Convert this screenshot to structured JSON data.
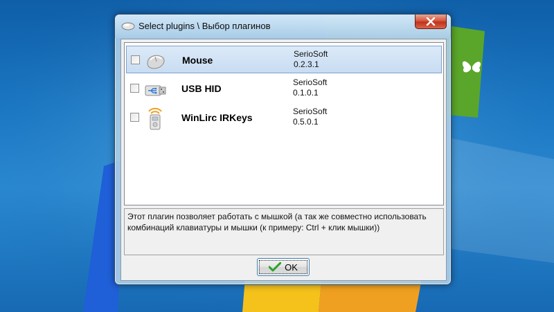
{
  "window": {
    "title": "Select plugins \\ Выбор плагинов",
    "close_icon": "close-icon"
  },
  "plugins": [
    {
      "name": "Mouse",
      "vendor": "SerioSoft",
      "version": "0.2.3.1",
      "icon": "mouse-icon",
      "checked": false,
      "selected": true
    },
    {
      "name": "USB HID",
      "vendor": "SerioSoft",
      "version": "0.1.0.1",
      "icon": "usb-icon",
      "checked": false,
      "selected": false
    },
    {
      "name": "WinLirc IRKeys",
      "vendor": "SerioSoft",
      "version": "0.5.0.1",
      "icon": "ir-remote-icon",
      "checked": false,
      "selected": false
    }
  ],
  "description": "Этот плагин позволяет работать с мышкой (а так же совместно использовать комбинаций клавиатуры и мышки (к примеру: Ctrl + клик мышки))",
  "ok_button": {
    "label": "OK",
    "icon": "checkmark-icon"
  },
  "colors": {
    "selection": "#cfe0f4",
    "close_button": "#c8412a",
    "check_green": "#2aa22a"
  }
}
